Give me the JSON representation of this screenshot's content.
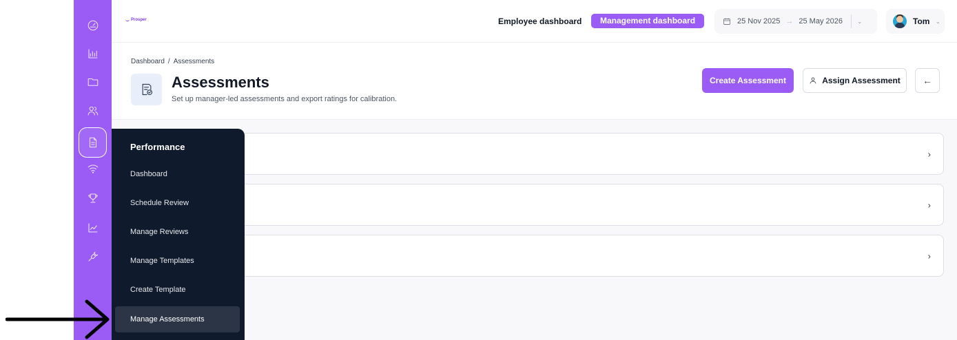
{
  "brand": {
    "name": "Prosper"
  },
  "header": {
    "employee_dashboard": "Employee dashboard",
    "management_dashboard": "Management dashboard",
    "date_start": "25 Nov 2025",
    "date_arrow": "→",
    "date_end": "25 May 2026",
    "user_name": "Tom"
  },
  "breadcrumb": {
    "items": [
      "Dashboard",
      "/",
      "Assessments"
    ]
  },
  "page": {
    "title": "Assessments",
    "subtitle": "Set up manager-led assessments and export ratings for calibration.",
    "create_button": "Create Assessment",
    "assign_button": "Assign Assessment"
  },
  "menu": {
    "title": "Performance",
    "items": [
      "Dashboard",
      "Schedule Review",
      "Manage Reviews",
      "Manage Templates",
      "Create Template",
      "Manage Assessments"
    ],
    "active": "Manage Assessments"
  },
  "icons": {
    "rail": [
      "gauge-icon",
      "bar-chart-icon",
      "folder-icon",
      "users-icon",
      "document-icon",
      "wifi-icon",
      "trophy-icon",
      "line-chart-icon",
      "plug-icon"
    ],
    "title": "document-check-icon",
    "back": "arrow-left-icon"
  },
  "colors": {
    "accent": "#9b5cf6",
    "menu_bg": "#0f1b2d"
  }
}
